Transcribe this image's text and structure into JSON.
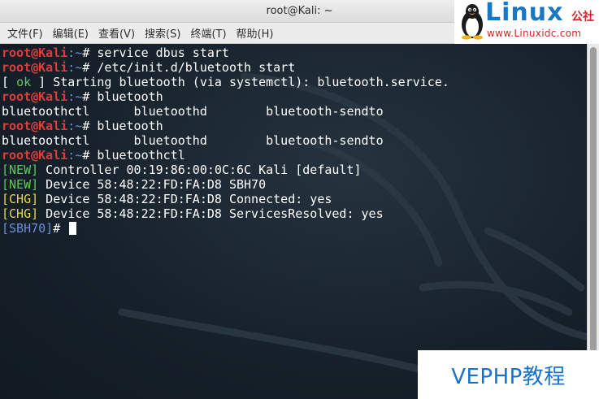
{
  "window": {
    "title": "root@Kali: ~"
  },
  "menu": {
    "items": [
      {
        "label": "文件(F)"
      },
      {
        "label": "编辑(E)"
      },
      {
        "label": "查看(V)"
      },
      {
        "label": "搜索(S)"
      },
      {
        "label": "终端(T)"
      },
      {
        "label": "帮助(H)"
      }
    ]
  },
  "logo": {
    "brand": "Linux",
    "brand_cn": "公社",
    "site": "www.Linuxidc.com"
  },
  "terminal": {
    "prompt_user": "root@Kali",
    "prompt_path": ":~",
    "prompt_symbol": "# ",
    "lines": [
      {
        "type": "prompt",
        "cmd": "service dbus start"
      },
      {
        "type": "prompt",
        "cmd": "/etc/init.d/bluetooth start"
      },
      {
        "type": "status",
        "open": "[ ",
        "tag": "ok",
        "close": " ] ",
        "text": "Starting bluetooth (via systemctl): bluetooth.service."
      },
      {
        "type": "prompt",
        "cmd": "bluetooth"
      },
      {
        "type": "output",
        "text": "bluetoothctl      bluetoothd        bluetooth-sendto"
      },
      {
        "type": "prompt",
        "cmd": "bluetooth"
      },
      {
        "type": "output",
        "text": "bluetoothctl      bluetoothd        bluetooth-sendto"
      },
      {
        "type": "prompt",
        "cmd": "bluetoothctl"
      },
      {
        "type": "event",
        "tag": "NEW",
        "text": " Controller 00:19:86:00:0C:6C Kali [default]"
      },
      {
        "type": "event",
        "tag": "NEW",
        "text": " Device 58:48:22:FD:FA:D8 SBH70"
      },
      {
        "type": "event",
        "tag": "CHG",
        "text": " Device 58:48:22:FD:FA:D8 Connected: yes"
      },
      {
        "type": "event",
        "tag": "CHG",
        "text": " Device 58:48:22:FD:FA:D8 ServicesResolved: yes"
      },
      {
        "type": "bt_prompt",
        "tag": "[SBH70]",
        "text": "# "
      }
    ]
  },
  "watermark": {
    "text": "VEPHP教程"
  },
  "colors": {
    "prompt_user": "#e03c3c",
    "prompt_path": "#6c8fd8",
    "new_tag": "#5dc85d",
    "chg_tag": "#e6d84a",
    "ok_tag": "#5dc85d"
  }
}
